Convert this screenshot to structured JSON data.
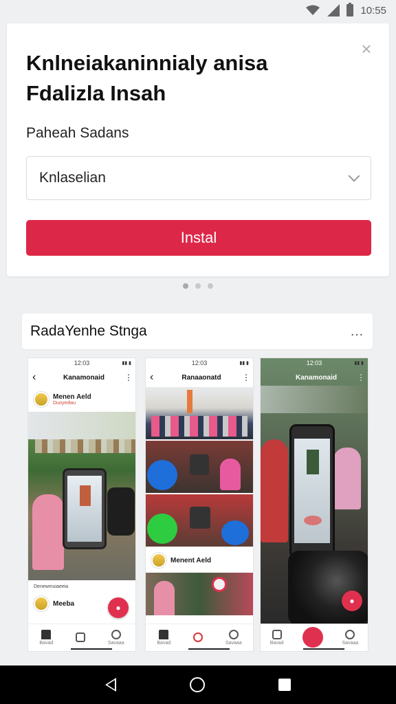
{
  "status": {
    "time": "10:55"
  },
  "card": {
    "title": "Knlneiakaninnialy anisa\nFdalizla Insah",
    "subtitle": "Paheah Sadans",
    "select_value": "Knlaselian",
    "install_label": "Instal"
  },
  "section": {
    "title": "RadaYenhe Stnga",
    "more": "…"
  },
  "shots": [
    {
      "time": "12:03",
      "header": "Kanamonaid",
      "user_name": "Menen Aeld",
      "user_sub": "Duoyedwu"
    },
    {
      "time": "12:03",
      "header": "Ranaaonatd",
      "user_name": "Menent Aeld"
    },
    {
      "time": "12:03",
      "header": "Kanamonaid"
    }
  ],
  "p1_bottom": {
    "label": "Denewmuiaeeia",
    "user": "Meeba"
  },
  "nav_labels": {
    "home": "Bavad",
    "activity": "",
    "profile": "Savaaa"
  },
  "colors": {
    "accent": "#dc2748"
  }
}
